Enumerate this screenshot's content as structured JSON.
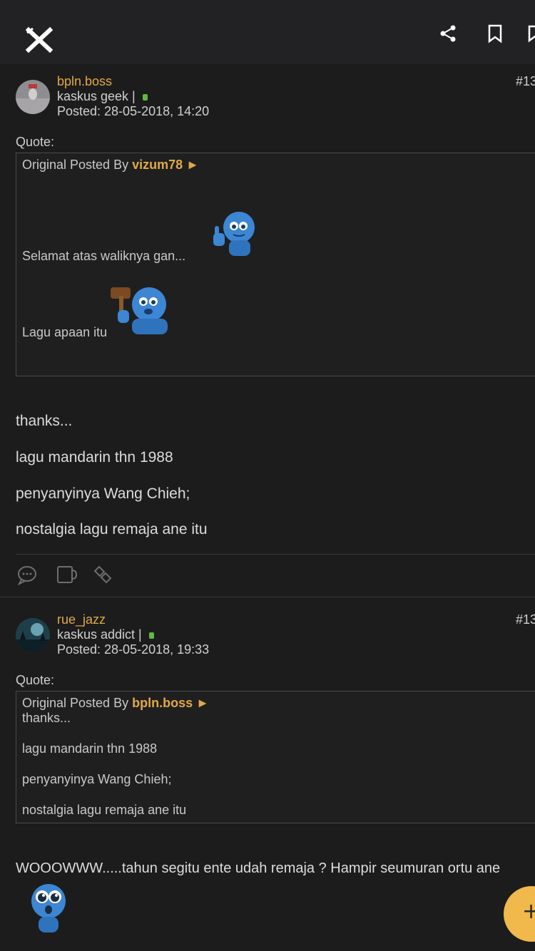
{
  "header": {
    "close_icon": "close-x-icon",
    "actions": [
      "share-icon",
      "bookmark-icon",
      "bookmark-alt-icon"
    ]
  },
  "posts": [
    {
      "username": "bpln.boss",
      "rank": "kaskus geek |",
      "posted": "Posted: 28-05-2018, 14:20",
      "post_no": "#13",
      "quote_label": "Quote:",
      "quote_by_prefix": "Original Posted By",
      "quote_author": "vizum78",
      "quote_lines": [
        "Selamat atas waliknya gan...",
        "Lagu apaan itu"
      ],
      "body": [
        "thanks...",
        "lagu mandarin thn 1988",
        "penyanyinya Wang Chieh;",
        "nostalgia lagu remaja ane itu"
      ]
    },
    {
      "username": "rue_jazz",
      "rank": "kaskus addict |",
      "posted": "Posted: 28-05-2018, 19:33",
      "post_no": "#13",
      "quote_label": "Quote:",
      "quote_by_prefix": "Original Posted By",
      "quote_author": "bpln.boss",
      "quote_lines": [
        "thanks...",
        "lagu mandarin thn 1988",
        "penyanyinya Wang Chieh;",
        "nostalgia lagu remaja ane itu"
      ],
      "body": [
        "WOOOWWW.....tahun segitu ente udah remaja ? Hampir seumuran ortu ane"
      ]
    }
  ],
  "post_actions": [
    "reply-icon",
    "quote-icon",
    "link-icon"
  ],
  "fab_label": "+",
  "colors": {
    "accent": "#e0a947",
    "online": "#5dbb3f",
    "fab": "#f1b84c",
    "background": "#1c1c1d"
  }
}
